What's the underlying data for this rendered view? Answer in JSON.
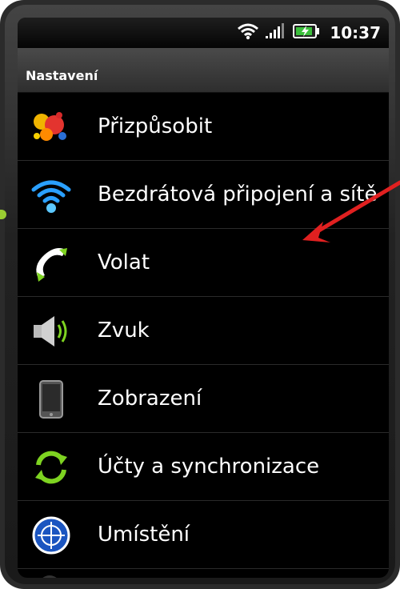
{
  "status_bar": {
    "time": "10:37",
    "icons": [
      "wifi-icon",
      "signal-icon",
      "battery-charging-icon"
    ]
  },
  "header": {
    "title": "Nastavení"
  },
  "settings": [
    {
      "label": "Přizpůsobit",
      "icon": "personalize-icon"
    },
    {
      "label": "Bezdrátová připojení a sítě",
      "icon": "wireless-icon"
    },
    {
      "label": "Volat",
      "icon": "phone-icon"
    },
    {
      "label": "Zvuk",
      "icon": "speaker-icon"
    },
    {
      "label": "Zobrazení",
      "icon": "display-icon"
    },
    {
      "label": "Účty a synchronizace",
      "icon": "sync-icon"
    },
    {
      "label": "Umístění",
      "icon": "location-icon"
    }
  ],
  "annotation": {
    "color": "#e02020"
  }
}
